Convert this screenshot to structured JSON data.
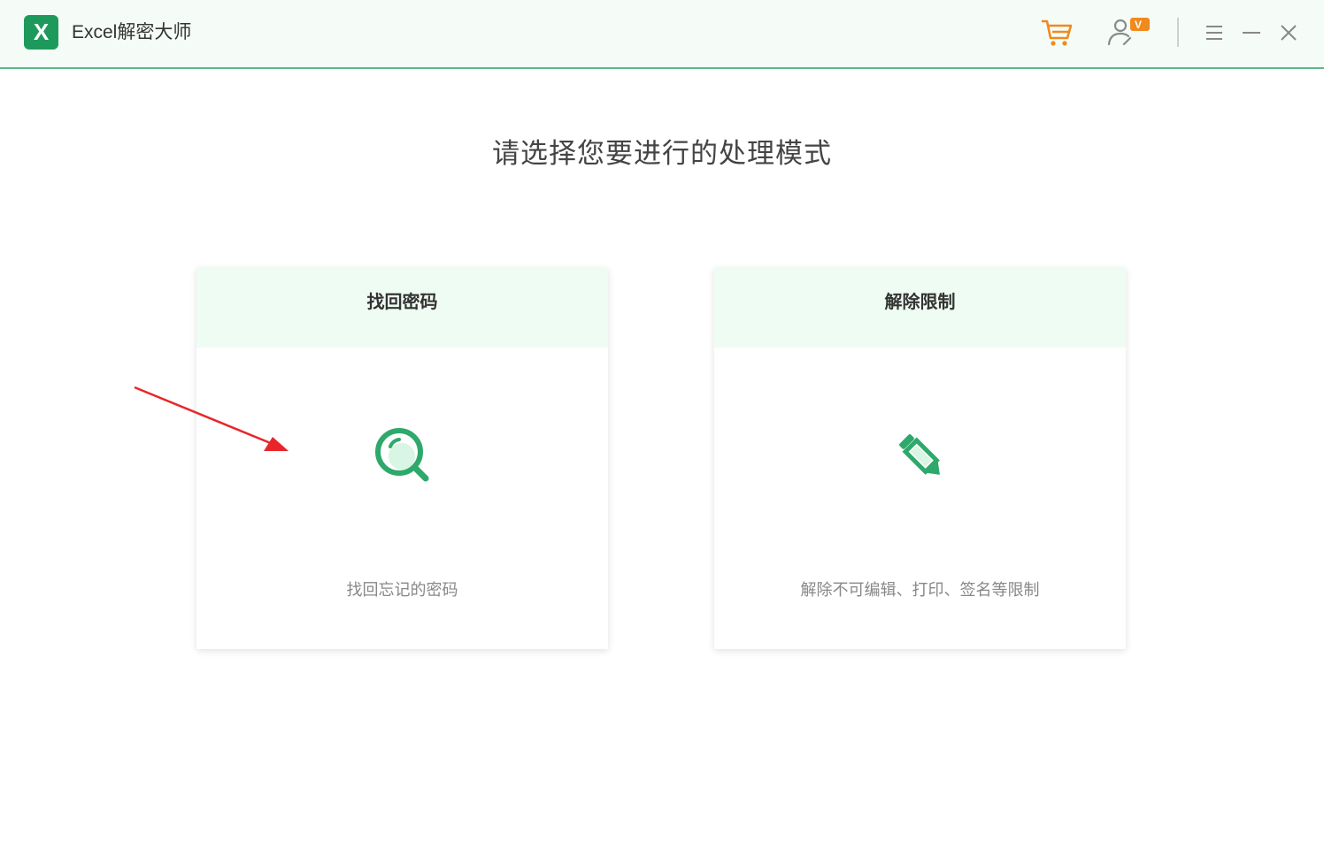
{
  "app": {
    "logo_letter": "X",
    "title": "Excel解密大师"
  },
  "toolbar": {
    "icons": [
      "cart-icon",
      "user-vip-icon",
      "menu-icon",
      "minimize-icon",
      "close-icon"
    ],
    "vip_badge": "V"
  },
  "main": {
    "heading": "请选择您要进行的处理模式",
    "cards": [
      {
        "title": "找回密码",
        "description": "找回忘记的密码",
        "icon": "magnifier-icon"
      },
      {
        "title": "解除限制",
        "description": "解除不可编辑、打印、签名等限制",
        "icon": "pencil-icon"
      }
    ]
  },
  "colors": {
    "accent": "#1d9a5b",
    "icon_green": "#2ea96b",
    "toolbar_orange": "#f08a1c",
    "card_header_bg": "#effcf3",
    "annotation_arrow": "#e8262a"
  }
}
